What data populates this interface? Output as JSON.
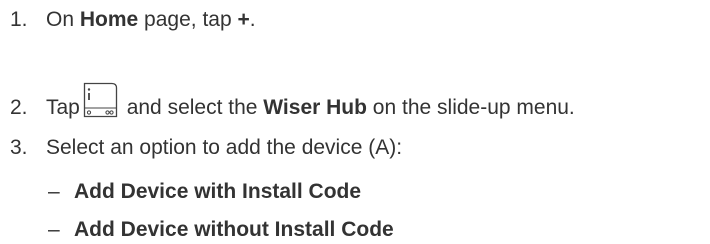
{
  "steps": [
    {
      "number": "1.",
      "text_a": "On ",
      "bold_a": "Home",
      "text_b": " page, tap ",
      "bold_b": "+",
      "text_c": "."
    },
    {
      "number": "2.",
      "text_a": "Tap",
      "icon": "wiser-hub-device-icon",
      "text_b": " and select the ",
      "bold_a": "Wiser Hub",
      "text_c": " on the slide-up menu."
    },
    {
      "number": "3.",
      "text_a": "Select an option to add the device (A):"
    }
  ],
  "options": [
    {
      "dash": "–",
      "label": "Add Device with Install Code"
    },
    {
      "dash": "–",
      "label": "Add Device without Install Code"
    }
  ],
  "colors": {
    "text": "#333333",
    "background": "#ffffff"
  }
}
